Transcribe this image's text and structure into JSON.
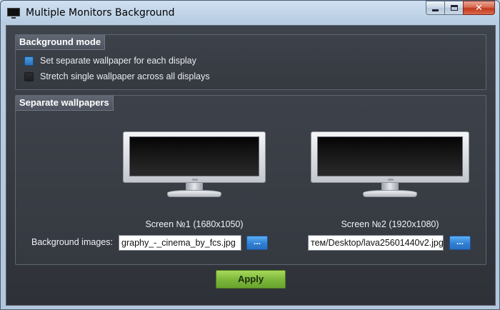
{
  "window": {
    "title": "Multiple Monitors Background",
    "icon": "monitor-icon",
    "caption_buttons": {
      "minimize": "minimize-icon",
      "maximize": "maximize-icon",
      "close_glyph": "✕"
    }
  },
  "background_mode": {
    "title": "Background mode",
    "options": [
      {
        "label": "Set separate wallpaper for each display",
        "selected": true
      },
      {
        "label": "Stretch single wallpaper across all displays",
        "selected": false
      }
    ]
  },
  "separate_wallpapers": {
    "title": "Separate wallpapers",
    "background_images_label": "Background images:",
    "screens": [
      {
        "label": "Screen №1 (1680x1050)",
        "path": "graphy_-_cinema_by_fcs.jpg",
        "browse": "..."
      },
      {
        "label": "Screen №2 (1920x1080)",
        "path": "тем/Desktop/lava25601440v2.jpg",
        "browse": "..."
      }
    ]
  },
  "apply_label": "Apply",
  "colors": {
    "accent_blue": "#2f7fd4",
    "apply_green": "#7ab63a",
    "panel_dark": "#353940"
  }
}
